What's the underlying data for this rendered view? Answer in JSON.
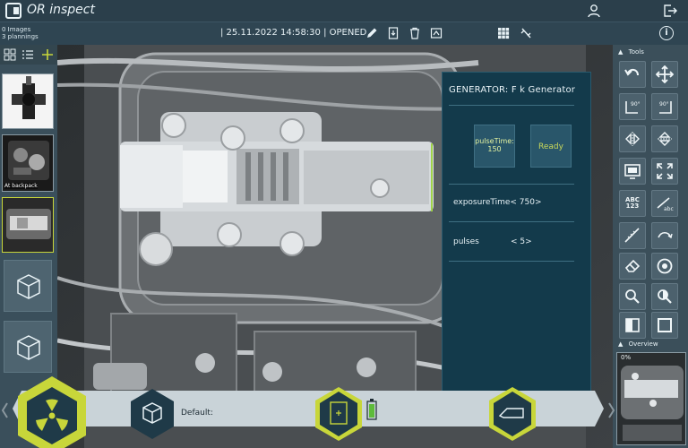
{
  "app": {
    "brand": "OR inspect"
  },
  "session": {
    "counts_images": "0 Images",
    "counts_plannings": "3 plannings",
    "status_text": "| 25.11.2022 14:58:30 | OPENED"
  },
  "thumbnails": [
    {
      "label": ""
    },
    {
      "label": "At backpack"
    },
    {
      "label": ""
    }
  ],
  "generator": {
    "title": "GENERATOR: F  k  Generator",
    "pulse_time_label": "pulseTime:",
    "pulse_time_value": "150",
    "ready_label": "Ready",
    "exposure_time": "exposureTime< 750>",
    "pulses_label": "pulses",
    "pulses_value": "< 5>"
  },
  "tools": {
    "title": "Tools",
    "abc_label": "ABC",
    "num_label": "123",
    "abc_small": "abc",
    "rotate_90_left": "90°",
    "rotate_90_right": "90°"
  },
  "overview": {
    "title": "Overview",
    "percent": "0%"
  },
  "bottom": {
    "default_label": "Default:"
  },
  "colors": {
    "accent": "#c8d63a",
    "panel": "#133a4b",
    "toolbar": "#3b4f5a"
  }
}
